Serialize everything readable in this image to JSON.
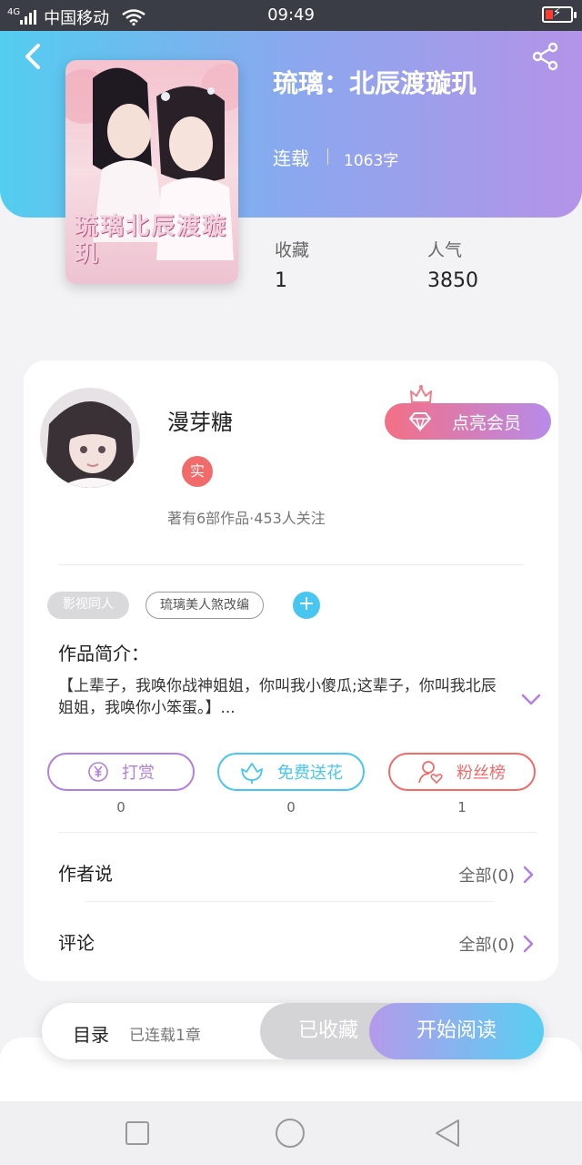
{
  "status_bar": {
    "network": "4G",
    "carrier": "中国移动",
    "time": "09:49"
  },
  "book": {
    "title": "琉璃：北辰渡璇玑",
    "serial_status": "连载",
    "word_count": "1063字",
    "cover_title": "琉璃北辰渡璇玑"
  },
  "stats": {
    "favorites_label": "收藏",
    "favorites_value": "1",
    "popularity_label": "人气",
    "popularity_value": "3850"
  },
  "author": {
    "name": "漫芽糖",
    "verified_badge": "实",
    "meta": "著有6部作品·453人关注"
  },
  "vip_button": "点亮会员",
  "tags": [
    "影视同人",
    "琉璃美人煞改编"
  ],
  "intro": {
    "label": "作品简介：",
    "text": "【上辈子，我唤你战神姐姐，你叫我小傻瓜;这辈子，你叫我北辰姐姐，我唤你小笨蛋。】..."
  },
  "actions": [
    {
      "label": "打赏",
      "count": "0",
      "icon": "yen-icon"
    },
    {
      "label": "免费送花",
      "count": "0",
      "icon": "flower-icon"
    },
    {
      "label": "粉丝榜",
      "count": "1",
      "icon": "user-heart-icon"
    }
  ],
  "rows": {
    "author_says_label": "作者说",
    "author_says_link": "全部(0)",
    "comments_label": "评论",
    "comments_link": "全部(0)"
  },
  "bottom_bar": {
    "catalog_label": "目录",
    "catalog_status": "已连载1章",
    "collected_label": "已收藏",
    "read_label": "开始阅读"
  },
  "colors": {
    "hero_start": "#53cdf0",
    "hero_end": "#b493e8",
    "purple": "#b27fe0",
    "cyan": "#48c6ef",
    "coral": "#f26b6b"
  }
}
